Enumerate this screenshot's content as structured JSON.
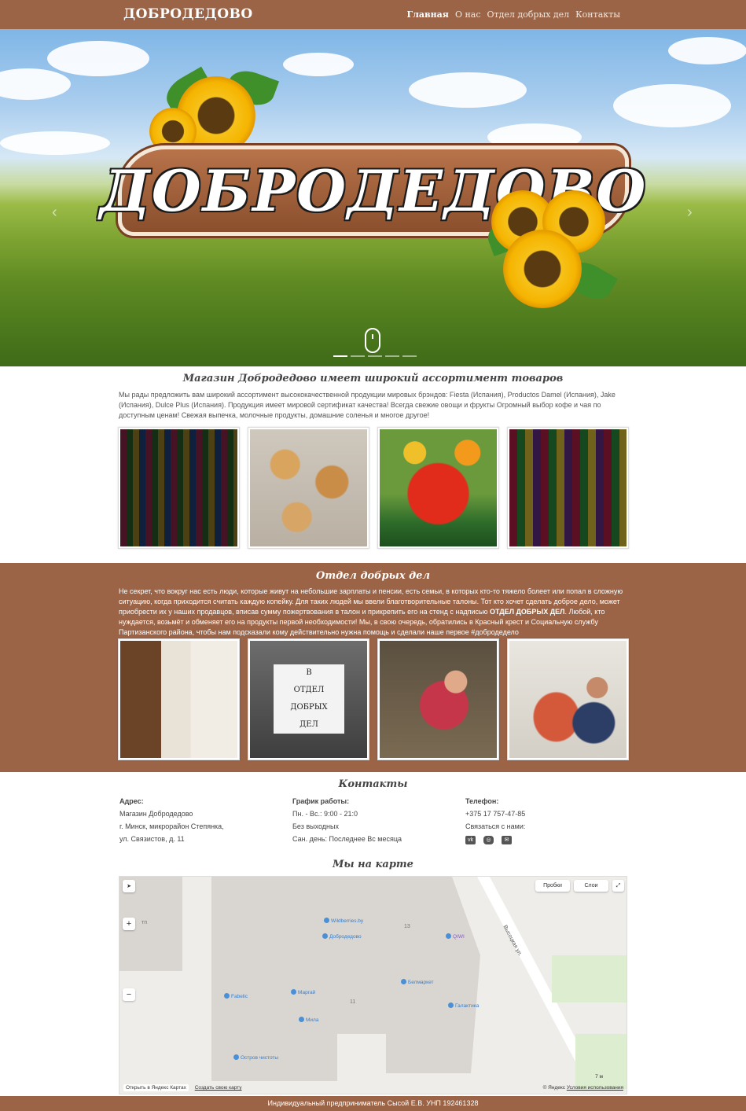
{
  "nav": {
    "brand": "ДОБРОДЕДОВО",
    "items": [
      {
        "label": "Главная",
        "active": true
      },
      {
        "label": "О нас",
        "active": false
      },
      {
        "label": "Отдел добрых дел",
        "active": false
      },
      {
        "label": "Контакты",
        "active": false
      }
    ]
  },
  "hero": {
    "logo_text": "ДОБРОДЕДОВО",
    "prev_icon": "chevron-left-icon",
    "next_icon": "chevron-right-icon"
  },
  "assortment": {
    "title": "Магазин Добродедово имеет широкий ассортимент товаров",
    "text": "Мы рады предложить вам широкий ассортимент высококачественной продукции мировых брэндов: Fiesta (Испания), Productos Damel (Испания), Jake (Испания), Dulce Plus (Испания). Продукция имеет мировой сертификат качества! Всегда свежие овощи и фрукты Огромный выбор кофе и чая по доступным ценам! Свежая выпечка, молочные продукты, домашние соленья и многое другое!"
  },
  "deeds": {
    "title": "Отдел добрых дел",
    "text_before": "Не секрет, что вокруг нас есть люди, которые живут на небольшие зарплаты и пенсии, есть семьи, в которых кто-то тяжело болеет или попал в сложную ситуацию, когда приходится считать каждую копейку. Для таких людей мы ввели благотворительные талоны. Тот кто хочет сделать доброе дело, может приобрести их у наших продавцов, вписав сумму пожертвования в талон и прикрепить его на стенд с надписью ",
    "text_bold": "ОТДЕЛ ДОБРЫХ ДЕЛ",
    "text_after": ". Любой, кто нуждается, возьмёт и обменяет его на продукты первой необходимости! Мы, в свою очередь, обратились в Красный крест и Социальную службу Партизанского района, чтобы нам подсказали кому действительно нужна помощь и сделали наше первое #добродедело",
    "jar_sign": [
      "В",
      "ОТДЕЛ",
      "ДОБРЫХ",
      "ДЕЛ"
    ]
  },
  "contacts": {
    "title": "Контакты",
    "address_label": "Адрес:",
    "address_lines": [
      "Магазин Добродедово",
      "г. Минск, микрорайон Степянка,",
      "ул. Связистов, д. 11"
    ],
    "schedule_label": "График работы:",
    "schedule_lines": [
      "Пн. - Вс.: 9:00 - 21:0",
      "Без выходных",
      "Сан. день: Последнее Вс месяца"
    ],
    "phone_label": "Телефон:",
    "phone": "+375 17 757-47-85",
    "connect_label": "Связаться с нами:",
    "social_icons": [
      "vk-icon",
      "instagram-icon",
      "mail-icon"
    ]
  },
  "map": {
    "title": "Мы на карте",
    "traffic_btn": "Пробки",
    "layers_btn": "Слои",
    "street": "Высоцкая ул.",
    "pois": [
      "Wildberries.by",
      "Добродедово",
      "QIWI",
      "Белмаркет",
      "Fabelic",
      "Маргай",
      "Мила",
      "Галактика",
      "Остров чистоты"
    ],
    "building_nums": [
      "13",
      "11",
      "тп"
    ],
    "scale": "7 м",
    "open_in": "Открыть в Яндекс Картах",
    "create_map": "Создать свою карту",
    "copyright": "© Яндекс",
    "terms": "Условия использования",
    "zoom_in": "+",
    "zoom_out": "−"
  },
  "footer": {
    "text": "Индивидуальный предприниматель Сысой Е.В. УНП 192461328"
  },
  "colors": {
    "brand_brown": "#9b6447",
    "sunflower": "#f5b400"
  }
}
